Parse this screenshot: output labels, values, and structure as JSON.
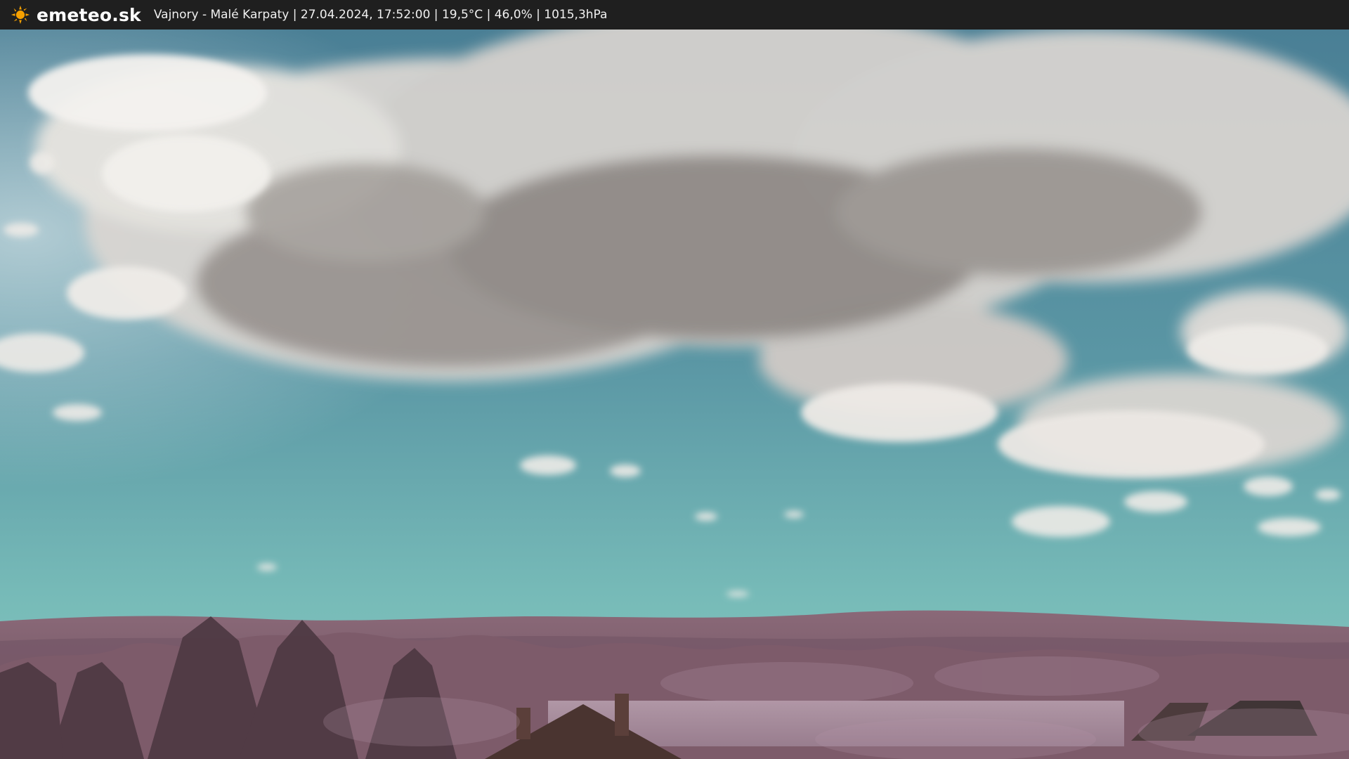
{
  "header": {
    "brand": "emeteo.sk",
    "location": "Vajnory - Malé Karpaty",
    "sep1": " | ",
    "datetime": "27.04.2024, 17:52:00",
    "sep2": " | ",
    "temperature": "19,5°C",
    "sep3": " | ",
    "humidity": "46,0%",
    "sep4": " | ",
    "pressure": "1015,3hPa"
  },
  "icons": {
    "logo": "sun-icon"
  },
  "colors": {
    "bar": "#1f1f1f",
    "sun": "#f5a000",
    "sky_top": "#4f879b",
    "sky_bottom": "#74b8b6",
    "cloud_light": "#e8e6e2",
    "cloud_shadow": "#7d7772",
    "hills": "#7f6170",
    "trees": "#6f4a58"
  }
}
